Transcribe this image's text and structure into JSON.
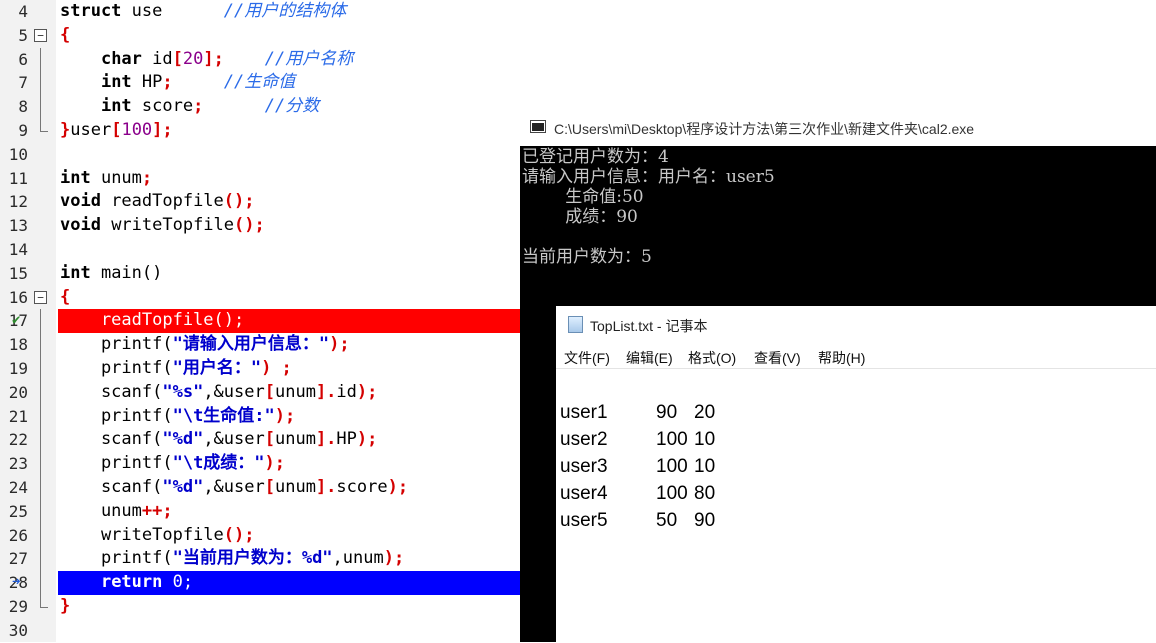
{
  "editor": {
    "lines": [
      {
        "n": "4"
      },
      {
        "n": "5"
      },
      {
        "n": "6"
      },
      {
        "n": "7"
      },
      {
        "n": "8"
      },
      {
        "n": "9"
      },
      {
        "n": "10"
      },
      {
        "n": "11"
      },
      {
        "n": "12"
      },
      {
        "n": "13"
      },
      {
        "n": "14"
      },
      {
        "n": "15"
      },
      {
        "n": "16"
      },
      {
        "n": "17"
      },
      {
        "n": "18"
      },
      {
        "n": "19"
      },
      {
        "n": "20"
      },
      {
        "n": "21"
      },
      {
        "n": "22"
      },
      {
        "n": "23"
      },
      {
        "n": "24"
      },
      {
        "n": "25"
      },
      {
        "n": "26"
      },
      {
        "n": "27"
      },
      {
        "n": "28"
      },
      {
        "n": "29"
      },
      {
        "n": "30"
      }
    ],
    "code": {
      "l4_kw": "struct",
      "l4_rest": " use      ",
      "l4_cm": "//用户的结构体",
      "l5": "{",
      "l6_kw": "char",
      "l6_a": " id",
      "l6_b": "[",
      "l6_n": "20",
      "l6_c": "];",
      "l6_cm": "    //用户名称",
      "l7_kw": "int",
      "l7_a": " HP",
      "l7_c": ";",
      "l7_cm": "     //生命值",
      "l8_kw": "int",
      "l8_a": " score",
      "l8_c": ";",
      "l8_cm": "      //分数",
      "l9_a": "}",
      "l9_b": "user",
      "l9_c": "[",
      "l9_n": "100",
      "l9_d": "];",
      "l11_kw": "int",
      "l11_a": " unum",
      "l11_c": ";",
      "l12_kw": "void",
      "l12_a": " readTopfile",
      "l12_c": "();",
      "l13_kw": "void",
      "l13_a": " writeTopfile",
      "l13_c": "();",
      "l15_kw": "int",
      "l15_a": " main()",
      "l16": "{",
      "l17": "    readTopfile();",
      "l18_a": "    printf(",
      "l18_s": "\"请输入用户信息：\"",
      "l18_c": ");",
      "l19_a": "    printf(",
      "l19_s": "\"用户名：\"",
      "l19_c": ") ;",
      "l20_a": "    scanf(",
      "l20_s": "\"%s\"",
      "l20_b": ",&user",
      "l20_c": "[",
      "l20_d": "unum",
      "l20_e": "].",
      "l20_f": "id",
      "l20_g": ");",
      "l21_a": "    printf(",
      "l21_s": "\"\\t生命值:\"",
      "l21_c": ");",
      "l22_a": "    scanf(",
      "l22_s": "\"%d\"",
      "l22_b": ",&user",
      "l22_c": "[",
      "l22_d": "unum",
      "l22_e": "].",
      "l22_f": "HP",
      "l22_g": ");",
      "l23_a": "    printf(",
      "l23_s": "\"\\t成绩：\"",
      "l23_c": ");",
      "l24_a": "    scanf(",
      "l24_s": "\"%d\"",
      "l24_b": ",&user",
      "l24_c": "[",
      "l24_d": "unum",
      "l24_e": "].",
      "l24_f": "score",
      "l24_g": ");",
      "l25_a": "    unum",
      "l25_c": "++;",
      "l26_a": "    writeTopfile",
      "l26_c": "();",
      "l27_a": "    printf(",
      "l27_s": "\"当前用户数为：%d\"",
      "l27_b": ",unum",
      "l27_c": ");",
      "l28_a": "    ",
      "l28_kw": "return",
      "l28_b": " 0;",
      "l29": "}"
    }
  },
  "console": {
    "title": "C:\\Users\\mi\\Desktop\\程序设计方法\\第三次作业\\新建文件夹\\cal2.exe",
    "lines": [
      "已登记用户数为：4",
      "请输入用户信息：用户名：user5",
      "        生命值:50",
      "        成绩：90",
      "",
      "当前用户数为：5"
    ]
  },
  "notepad": {
    "title": "TopList.txt - 记事本",
    "menu": [
      "文件(F)",
      "编辑(E)",
      "格式(O)",
      "查看(V)",
      "帮助(H)"
    ],
    "records": [
      {
        "name": "user1",
        "hp": "90",
        "score": "20"
      },
      {
        "name": "user2",
        "hp": "100",
        "score": "10"
      },
      {
        "name": "user3",
        "hp": "100",
        "score": "10"
      },
      {
        "name": "user4",
        "hp": "100",
        "score": "80"
      },
      {
        "name": "user5",
        "hp": "50",
        "score": "90"
      }
    ]
  },
  "colors": {
    "breakpoint_line": "#ff0000",
    "current_line": "#0000ff",
    "comment": "#2b6be8",
    "string": "#0000cc",
    "console_bg": "#000000"
  }
}
